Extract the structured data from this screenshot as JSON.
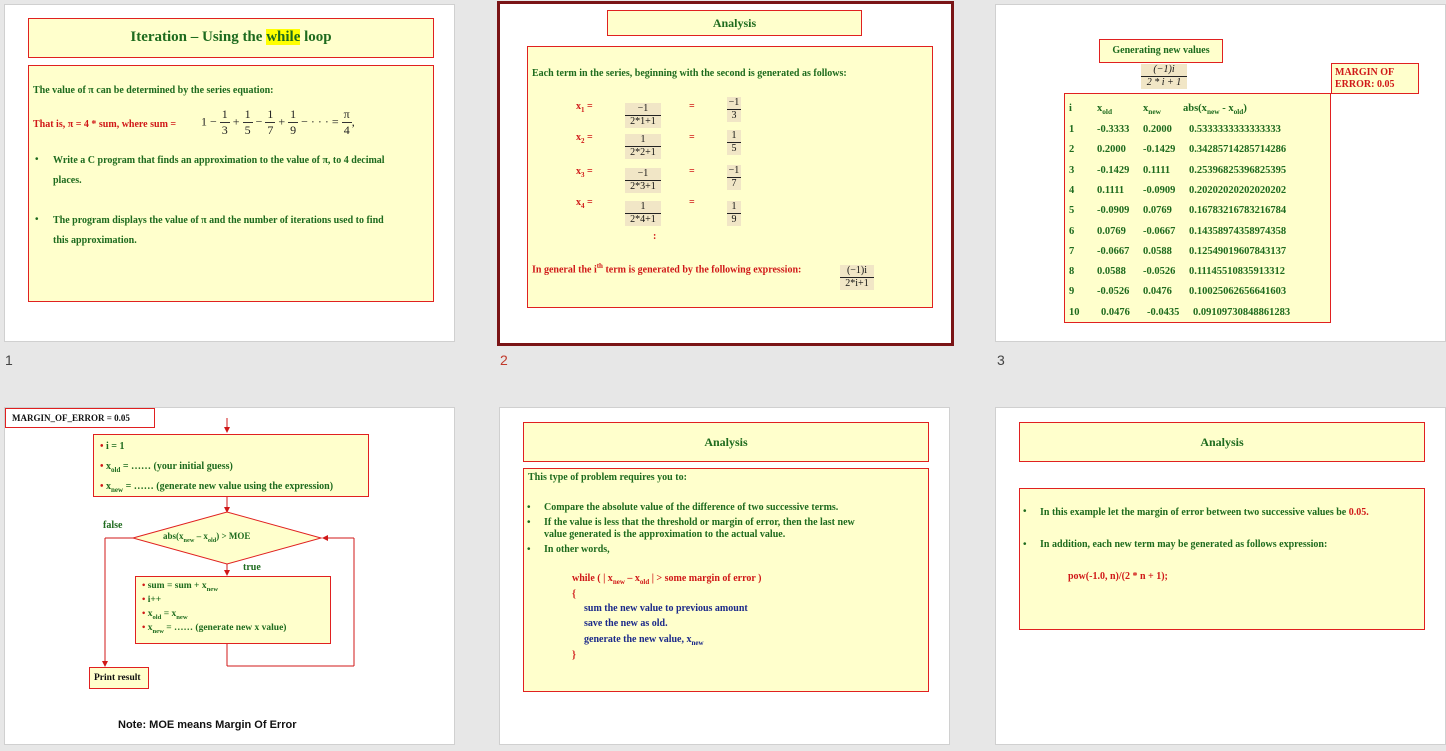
{
  "slide_numbers": [
    "1",
    "2",
    "3"
  ],
  "slide1": {
    "title_pre": "Iteration – Using the ",
    "title_hl": "while",
    "title_post": " loop",
    "line1": "The value of π can be determined by the series equation:",
    "line2": "That is, π = 4 * sum, where sum =",
    "formula_lead": "1 −",
    "f1n": "1",
    "f1d": "3",
    "op1": "+",
    "f2n": "1",
    "f2d": "5",
    "op2": "−",
    "f3n": "1",
    "f3d": "7",
    "op3": "+",
    "f4n": "1",
    "f4d": "9",
    "op4": "− · · · =",
    "f5n": "π",
    "f5d": "4",
    "op5": ",",
    "bullet1a": "Write a C program that finds an approximation to the value of π, to 4 decimal",
    "bullet1b": "places.",
    "bullet2a": "The program displays the value of π and the number of iterations used to find",
    "bullet2b": "this approximation."
  },
  "slide2": {
    "title": "Analysis",
    "intro": "Each term in the series, beginning with the second is generated as follows:",
    "rows": [
      {
        "lhs": "x",
        "sub": "1",
        "eq": "=",
        "num": "−1",
        "den": "2*1+1",
        "eq2": "=",
        "rnum": "−1",
        "rden": "3"
      },
      {
        "lhs": "x",
        "sub": "2",
        "eq": "=",
        "num": "1",
        "den": "2*2+1",
        "eq2": "=",
        "rnum": "1",
        "rden": "5"
      },
      {
        "lhs": "x",
        "sub": "3",
        "eq": "=",
        "num": "−1",
        "den": "2*3+1",
        "eq2": "=",
        "rnum": "−1",
        "rden": "7"
      },
      {
        "lhs": "x",
        "sub": "4",
        "eq": "=",
        "num": "1",
        "den": "2*4+1",
        "eq2": "=",
        "rnum": "1",
        "rden": "9"
      }
    ],
    "dots": ":",
    "general_pre": "In general the i",
    "general_sup": "th",
    "general_post": " term is generated by the following expression:",
    "gen_num": "(−1)i",
    "gen_den": "2*i+1"
  },
  "slide3": {
    "title": "Generating new values",
    "expr_num": "(−1)i",
    "expr_den": "2 * i + 1",
    "margin_line1": "MARGIN OF",
    "margin_line2": "ERROR: 0.05",
    "headers": [
      "i",
      "x",
      "x",
      "abs(x"
    ],
    "header_subs": [
      "",
      "old",
      "new",
      "new"
    ],
    "header_tail": " - x",
    "header_tail_sub": "old",
    "header_close": ")",
    "rows": [
      [
        "1",
        "-0.3333",
        "0.2000",
        "0.5333333333333333"
      ],
      [
        "2",
        "0.2000",
        "-0.1429",
        "0.34285714285714286"
      ],
      [
        "3",
        "-0.1429",
        "0.1111",
        "0.25396825396825395"
      ],
      [
        "4",
        "0.1111",
        "-0.0909",
        "0.20202020202020202"
      ],
      [
        "5",
        "-0.0909",
        "0.0769",
        "0.16783216783216784"
      ],
      [
        "6",
        "0.0769",
        "-0.0667",
        "0.14358974358974358"
      ],
      [
        "7",
        "-0.0667",
        "0.0588",
        "0.12549019607843137"
      ],
      [
        "8",
        "0.0588",
        "-0.0526",
        "0.11145510835913312"
      ],
      [
        "9",
        "-0.0526",
        "0.0476",
        "0.10025062656641603"
      ],
      [
        "10",
        "0.0476",
        "-0.0435",
        "0.09109730848861283"
      ]
    ]
  },
  "slide4": {
    "moe": "MARGIN_OF_ERROR = 0.05",
    "init1": "i = 1",
    "init2_x": "x",
    "init2_sub": "old",
    "init2_rest": " = …… (your initial guess)",
    "init3_x": "x",
    "init3_sub": "new",
    "init3_rest": " = …… (generate new value using the expression)",
    "false_label": "false",
    "true_label": "true",
    "cond_a": "abs(x",
    "cond_sub1": "new",
    "cond_b": " – x",
    "cond_sub2": "old",
    "cond_c": ") > MOE",
    "body1_a": "sum = sum + x",
    "body1_sub": "new",
    "body2": "i++",
    "body3_a": "x",
    "body3_sub1": "old",
    "body3_b": " = x",
    "body3_sub2": "new",
    "body4_a": "x",
    "body4_sub": "new",
    "body4_b": " = …… (generate new x value)",
    "print": "Print result",
    "note": "Note: MOE means Margin Of Error"
  },
  "slide5": {
    "title": "Analysis",
    "intro": "This type of problem requires you to:",
    "b1": "Compare the absolute value of the difference of two successive terms.",
    "b2a": "If the value is less that the threshold or margin of error, then the last new",
    "b2b": "value generated is the approximation to the actual value.",
    "b3": "In other words,",
    "code1_a": "while (  | x",
    "code1_sub1": "new",
    "code1_b": " – x",
    "code1_sub2": "old",
    "code1_c": " |  > some margin of error  )",
    "code2": "{",
    "code3": "sum the new value to previous amount",
    "code4": "save the new as old.",
    "code5_a": "generate the new value, x",
    "code5_sub": "new",
    "code6": "}"
  },
  "slide6": {
    "title": "Analysis",
    "b1_a": "In this example let the margin of error between two successive values be ",
    "b1_b": "0.05.",
    "b2": "In addition, each new term may be generated as follows expression:",
    "code": "pow(-1.0, n)/(2 * n + 1);"
  },
  "colors": {
    "panel": "#ffffcc",
    "border": "#e02020",
    "text_green": "#1e6b1e",
    "text_red": "#d01818",
    "selected_frame": "#7a1416"
  }
}
